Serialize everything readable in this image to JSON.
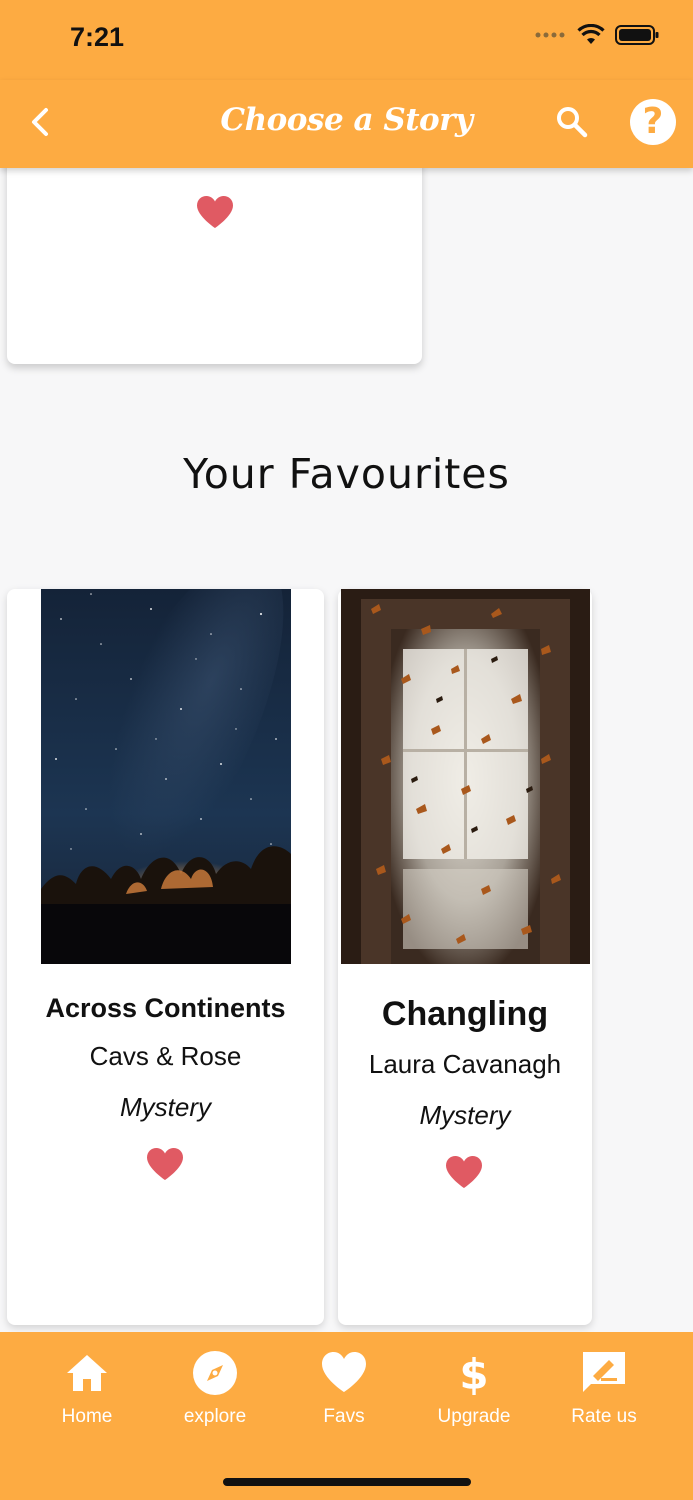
{
  "status_bar": {
    "time": "7:21"
  },
  "nav": {
    "title": "Choose a Story"
  },
  "section": {
    "title": "Your Favourites"
  },
  "favourites": [
    {
      "title": "Across Continents",
      "author": "Cavs & Rose",
      "genre": "Mystery",
      "cover": "starry-night-sky-image"
    },
    {
      "title": "Changling",
      "author": "Laura Cavanagh",
      "genre": "Mystery",
      "cover": "butterflies-doorway-image"
    }
  ],
  "tabs": [
    {
      "label": "Home",
      "icon": "home-icon"
    },
    {
      "label": "explore",
      "icon": "compass-icon"
    },
    {
      "label": "Favs",
      "icon": "heart-icon"
    },
    {
      "label": "Upgrade",
      "icon": "dollar-icon"
    },
    {
      "label": "Rate us",
      "icon": "rate-icon"
    }
  ],
  "colors": {
    "accent": "#fdab42",
    "heart": "#e05a63",
    "background": "#f7f7f8"
  }
}
